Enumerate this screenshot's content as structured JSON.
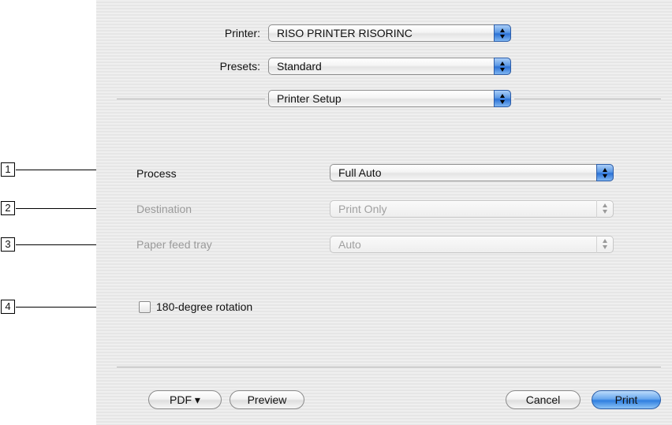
{
  "header": {
    "printer_label": "Printer:",
    "printer_value": "RISO PRINTER RISORINC",
    "presets_label": "Presets:",
    "presets_value": "Standard",
    "panel_value": "Printer Setup"
  },
  "settings": {
    "process_label": "Process",
    "process_value": "Full Auto",
    "destination_label": "Destination",
    "destination_value": "Print Only",
    "paper_feed_label": "Paper feed tray",
    "paper_feed_value": "Auto",
    "rotation_label": "180-degree rotation",
    "rotation_checked": false
  },
  "callouts": [
    "1",
    "2",
    "3",
    "4"
  ],
  "buttons": {
    "pdf": "PDF ▾",
    "preview": "Preview",
    "cancel": "Cancel",
    "print": "Print"
  },
  "colors": {
    "accent": "#3a86e0",
    "disabled_text": "#9a9a9a"
  }
}
